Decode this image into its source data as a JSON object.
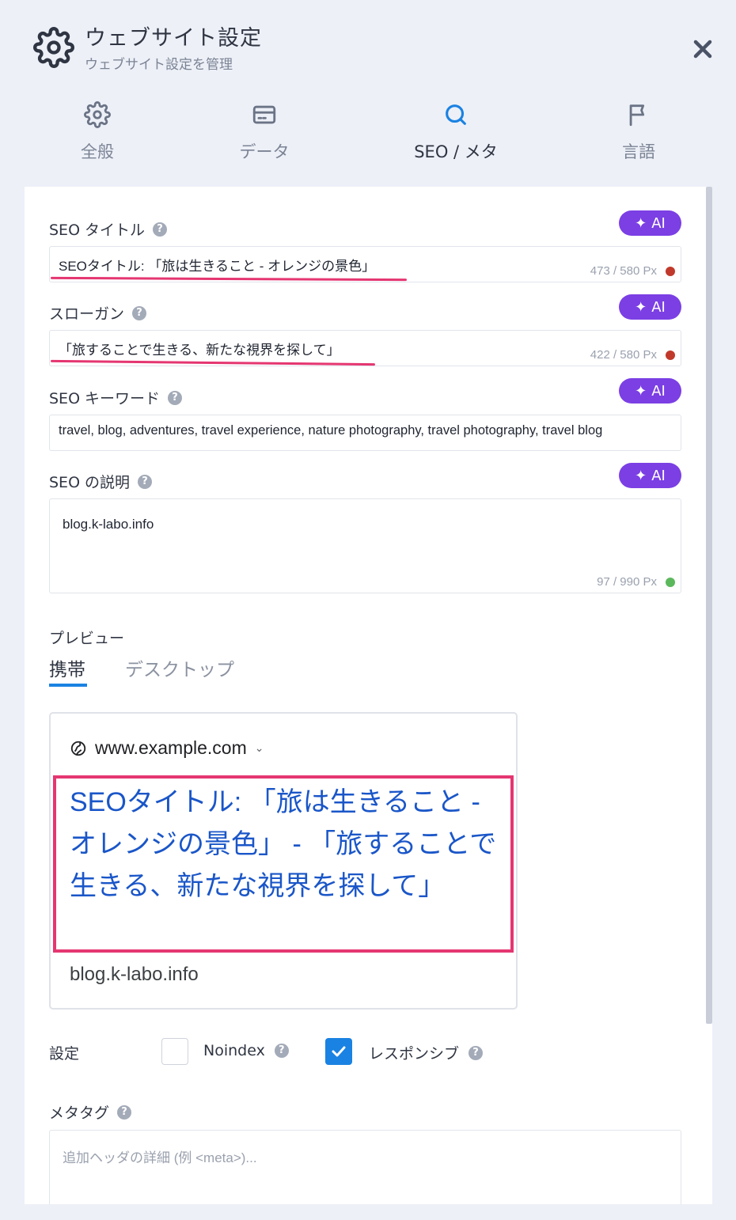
{
  "header": {
    "title": "ウェブサイト設定",
    "subtitle": "ウェブサイト設定を管理"
  },
  "tabs": [
    {
      "label": "全般",
      "icon": "gear-icon"
    },
    {
      "label": "データ",
      "icon": "card-icon"
    },
    {
      "label": "SEO / メタ",
      "icon": "search-icon"
    },
    {
      "label": "言語",
      "icon": "flag-icon"
    }
  ],
  "ai_label": "AI",
  "fields": {
    "seo_title": {
      "label": "SEO タイトル",
      "value": "SEOタイトル: 「旅は生きること - オレンジの景色」",
      "counter": "473 / 580 Px",
      "status_color": "#c0392b"
    },
    "slogan": {
      "label": "スローガン",
      "value": "「旅することで生きる、新たな視界を探して」",
      "counter": "422 / 580 Px",
      "status_color": "#c0392b"
    },
    "keywords": {
      "label": "SEO キーワード",
      "value": "travel, blog, adventures, travel experience, nature photography, travel photography, travel blog"
    },
    "description": {
      "label": "SEO の説明",
      "value": "blog.k-labo.info",
      "counter": "97 / 990 Px",
      "status_color": "#5cb85c"
    }
  },
  "preview": {
    "label": "プレビュー",
    "tabs": [
      "携帯",
      "デスクトップ"
    ],
    "url": "www.example.com",
    "title": "SEOタイトル: 「旅は生きること - オレンジの景色」 - 「旅することで生きる、新たな視界を探して」",
    "description": "blog.k-labo.info"
  },
  "settings": {
    "label": "設定",
    "noindex": {
      "label": "Noindex",
      "checked": false
    },
    "responsive": {
      "label": "レスポンシブ",
      "checked": true
    }
  },
  "metatags": {
    "label": "メタタグ",
    "placeholder": "追加ヘッダの詳細 (例 <meta>)..."
  },
  "colors": {
    "accent": "#1a82e2",
    "ai": "#7b3fe4",
    "highlight": "#e53671",
    "link": "#1a56c8"
  }
}
